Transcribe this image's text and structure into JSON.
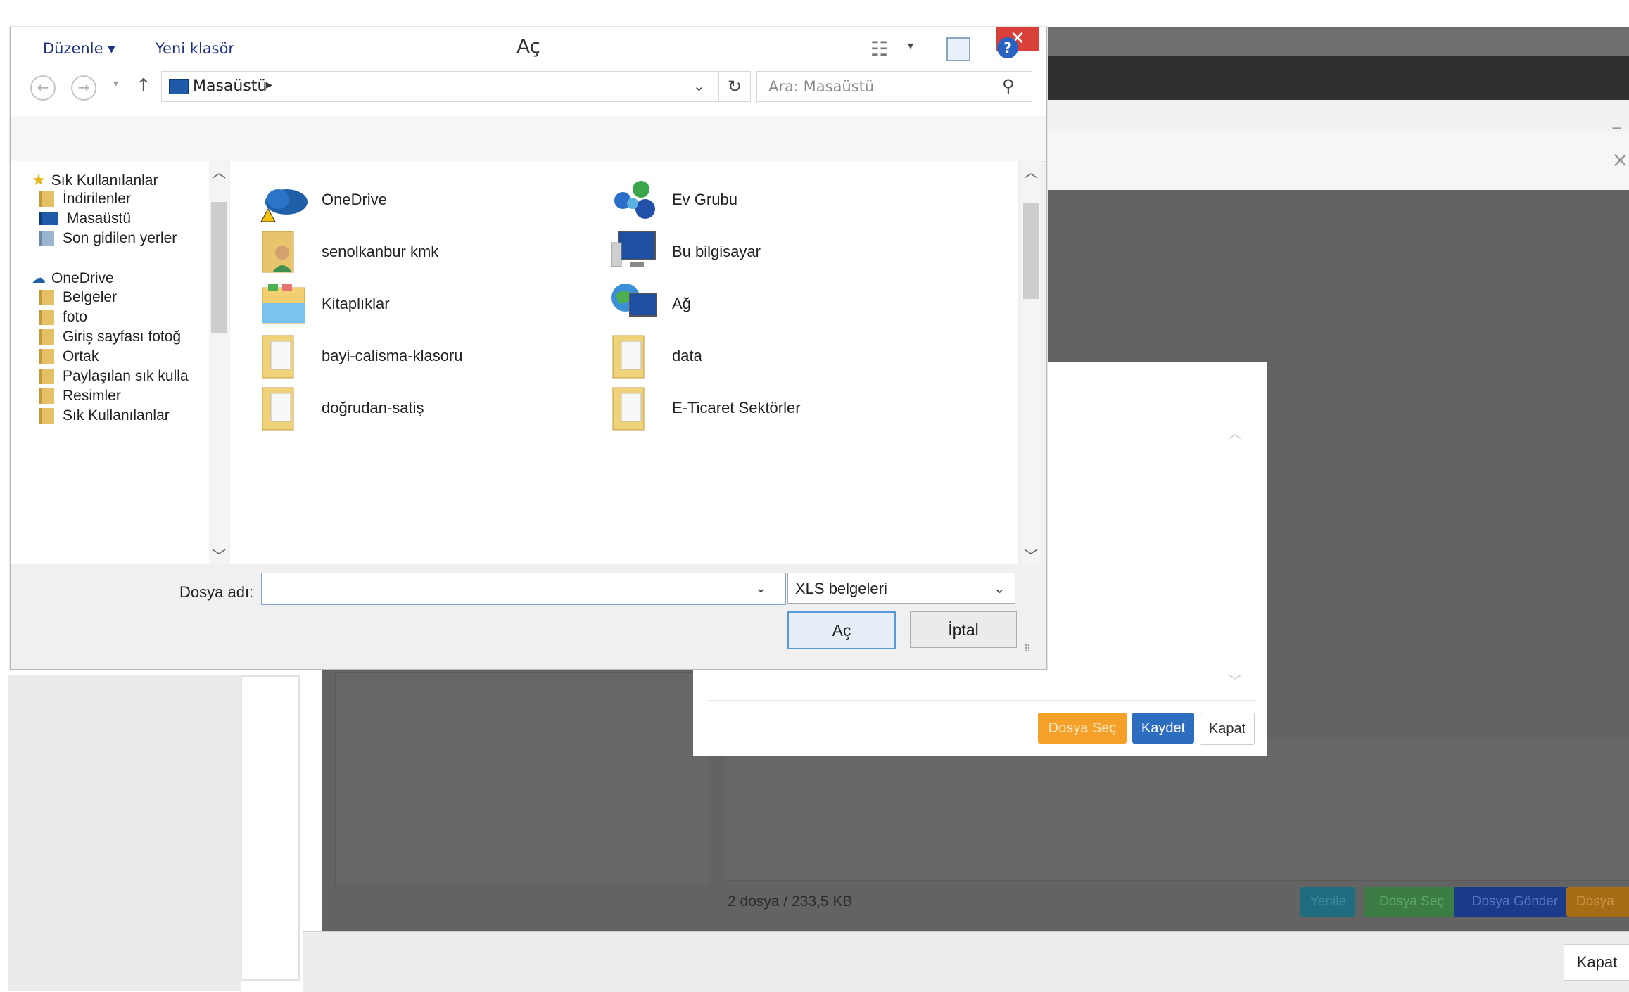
{
  "dialog": {
    "title": "Aç",
    "close_symbol": "✕",
    "address": "Masaüstü",
    "search_placeholder": "Ara: Masaüstü",
    "toolbar": {
      "organize_label": "Düzenle ▾",
      "new_folder_label": "Yeni klasör"
    },
    "nav_pane": {
      "items": [
        {
          "label": "Sık Kullanılanlar",
          "icon": "star-icon"
        },
        {
          "label": "İndirilenler",
          "icon": "downloads-folder-icon"
        },
        {
          "label": "Masaüstü",
          "icon": "desktop-icon"
        },
        {
          "label": "Son gidilen yerler",
          "icon": "recent-places-icon"
        },
        {
          "label": "OneDrive",
          "icon": "onedrive-icon"
        },
        {
          "label": "Belgeler",
          "icon": "folder-icon"
        },
        {
          "label": "foto",
          "icon": "folder-icon"
        },
        {
          "label": "Giriş sayfası fotoğ",
          "icon": "folder-icon"
        },
        {
          "label": "Ortak",
          "icon": "folder-icon"
        },
        {
          "label": "Paylaşılan sık kulla",
          "icon": "folder-icon"
        },
        {
          "label": "Resimler",
          "icon": "folder-icon"
        },
        {
          "label": "Sık Kullanılanlar",
          "icon": "folder-icon"
        }
      ]
    },
    "files": [
      {
        "label": "OneDrive",
        "icon": "onedrive-icon"
      },
      {
        "label": "Ev Grubu",
        "icon": "homegroup-icon"
      },
      {
        "label": "senolkanbur kmk",
        "icon": "user-folder-icon"
      },
      {
        "label": "Bu bilgisayar",
        "icon": "computer-icon"
      },
      {
        "label": "Kitaplıklar",
        "icon": "libraries-icon"
      },
      {
        "label": "Ağ",
        "icon": "network-icon"
      },
      {
        "label": "bayi-calisma-klasoru",
        "icon": "folder-icon"
      },
      {
        "label": "data",
        "icon": "folder-icon"
      },
      {
        "label": "doğrudan-satiş",
        "icon": "folder-icon"
      },
      {
        "label": "E-Ticaret Sektörler",
        "icon": "folder-icon"
      }
    ],
    "filename_label": "Dosya adı:",
    "filename_value": "",
    "filetype_value": "XLS belgeleri",
    "open_label": "Aç",
    "cancel_label": "İptal"
  },
  "background": {
    "small_dialog": {
      "select_file_label": "Dosya Seç",
      "save_label": "Kaydet",
      "close_label": "Kapat"
    },
    "status_text": "2 dosya / 233,5 KB",
    "action_buttons": {
      "refresh_label": "Yenile",
      "select_file_label": "Dosya Seç",
      "send_file_label": "Dosya Gönder",
      "delete_file_label": "Dosya Sil"
    },
    "footer_close_label": "Kapat"
  }
}
